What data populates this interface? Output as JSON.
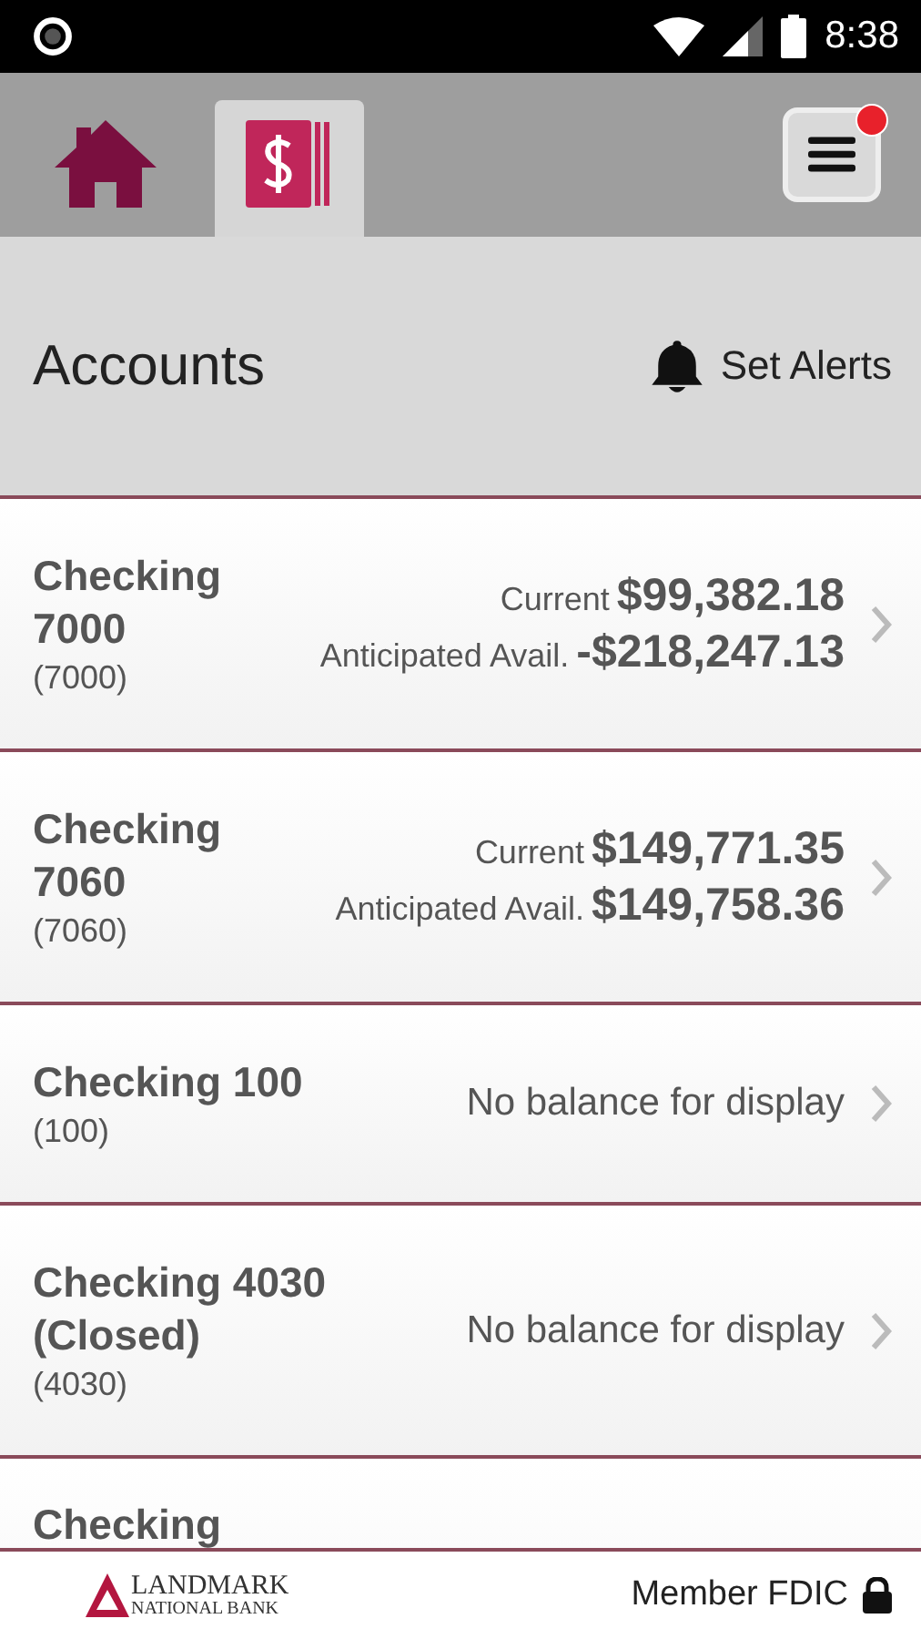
{
  "status_bar": {
    "time": "8:38"
  },
  "nav": {
    "tabs": [
      {
        "kind": "home",
        "selected": false
      },
      {
        "kind": "accounts",
        "selected": true
      }
    ],
    "menu": {
      "notification": true
    }
  },
  "header": {
    "title": "Accounts",
    "alerts_label": "Set Alerts"
  },
  "accounts": [
    {
      "kind": "balances",
      "name": "Checking 7000",
      "number": "(7000)",
      "current_label": "Current",
      "current": "$99,382.18",
      "avail_label": "Anticipated Avail.",
      "avail": "-$218,247.13"
    },
    {
      "kind": "balances",
      "name": "Checking 7060",
      "number": "(7060)",
      "current_label": "Current",
      "current": "$149,771.35",
      "avail_label": "Anticipated Avail.",
      "avail": "$149,758.36"
    },
    {
      "kind": "empty",
      "name": "Checking 100",
      "number": "(100)",
      "message": "No balance for display"
    },
    {
      "kind": "empty",
      "name": "Checking 4030 (Closed)",
      "number": "(4030)",
      "message": "No balance for display"
    },
    {
      "kind": "partial",
      "name": "Checking"
    }
  ],
  "footer": {
    "bank_line1": "LANDMARK",
    "bank_line2": "NATIONAL BANK",
    "fdic": "Member FDIC"
  }
}
